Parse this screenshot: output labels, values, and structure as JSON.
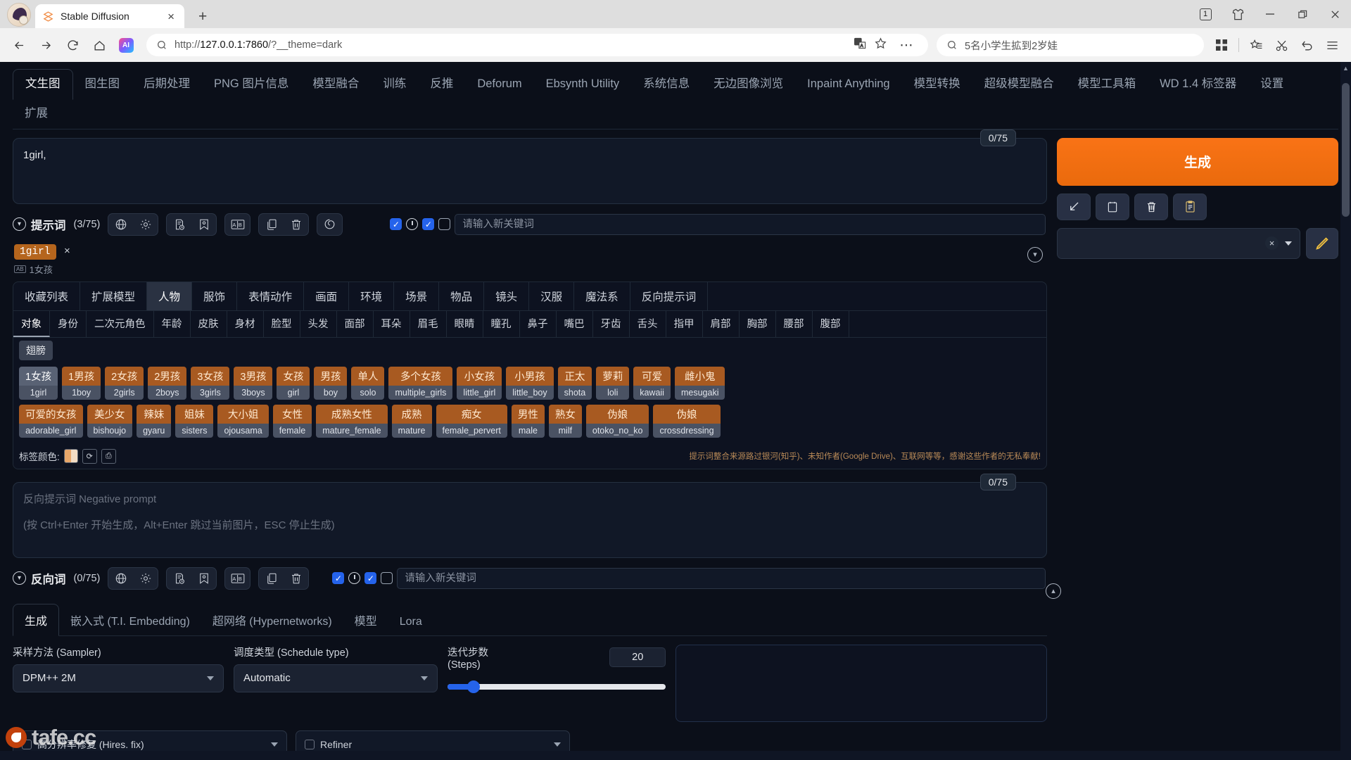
{
  "browser": {
    "tab_title": "Stable Diffusion",
    "tab_close": "×",
    "new_tab": "+",
    "tab_count": "1",
    "minimize": "—",
    "maximize": "❐",
    "close": "✕",
    "url_scheme": "http://",
    "url_host": "127.0.0.1:7860",
    "url_path": "/?__theme=dark",
    "search_query": "5名小学生拡到2岁娃",
    "icons": {
      "back": "back-icon",
      "forward": "forward-icon",
      "reload": "reload-icon",
      "home": "home-icon",
      "ai": "AI",
      "search": "search-icon",
      "translate": "translate-icon",
      "favorite": "star-icon",
      "more": "⋯",
      "apps": "apps-grid-icon",
      "collect": "star-plus-icon",
      "scissors": "scissors-icon",
      "undo": "undo-icon",
      "menu": "hamburger-menu-icon"
    }
  },
  "main_tabs": [
    {
      "label": "文生图",
      "active": true
    },
    {
      "label": "图生图",
      "active": false
    },
    {
      "label": "后期处理",
      "active": false
    },
    {
      "label": "PNG 图片信息",
      "active": false
    },
    {
      "label": "模型融合",
      "active": false
    },
    {
      "label": "训练",
      "active": false
    },
    {
      "label": "反推",
      "active": false
    },
    {
      "label": "Deforum",
      "active": false
    },
    {
      "label": "Ebsynth Utility",
      "active": false
    },
    {
      "label": "系统信息",
      "active": false
    },
    {
      "label": "无边图像浏览",
      "active": false
    },
    {
      "label": "Inpaint Anything",
      "active": false
    },
    {
      "label": "模型转换",
      "active": false
    },
    {
      "label": "超级模型融合",
      "active": false
    },
    {
      "label": "模型工具箱",
      "active": false
    },
    {
      "label": "WD 1.4 标签器",
      "active": false
    },
    {
      "label": "设置",
      "active": false
    },
    {
      "label": "扩展",
      "active": false
    }
  ],
  "prompt": {
    "counter": "0/75",
    "value": "1girl,",
    "placeholder": "",
    "label": "提示词",
    "count": "(3/75)",
    "keyword_placeholder": "请输入新关键词",
    "toolbar_icons": [
      "globe-icon",
      "gear-icon",
      "document-clock-icon",
      "bookmark-icon",
      "translate-ab-icon",
      "copy-icon",
      "trash-icon",
      "spiral-icon"
    ]
  },
  "negative": {
    "counter": "0/75",
    "placeholder_line1": "反向提示词 Negative prompt",
    "placeholder_line2": "(按 Ctrl+Enter 开始生成，Alt+Enter 跳过当前图片，ESC 停止生成)",
    "label": "反向词",
    "count": "(0/75)",
    "keyword_placeholder": "请输入新关键词"
  },
  "chip": {
    "text": "1girl",
    "remove": "×",
    "translation": "1女孩",
    "ab_badge": "AB"
  },
  "categories_row1": [
    {
      "label": "收藏列表",
      "active": false
    },
    {
      "label": "扩展模型",
      "active": false
    },
    {
      "label": "人物",
      "active": true
    },
    {
      "label": "服饰",
      "active": false
    },
    {
      "label": "表情动作",
      "active": false
    },
    {
      "label": "画面",
      "active": false
    },
    {
      "label": "环境",
      "active": false
    },
    {
      "label": "场景",
      "active": false
    },
    {
      "label": "物品",
      "active": false
    },
    {
      "label": "镜头",
      "active": false
    },
    {
      "label": "汉服",
      "active": false
    },
    {
      "label": "魔法系",
      "active": false
    },
    {
      "label": "反向提示词",
      "active": false
    }
  ],
  "categories_row2": [
    {
      "label": "对象",
      "active": true
    },
    {
      "label": "身份",
      "active": false
    },
    {
      "label": "二次元角色",
      "active": false
    },
    {
      "label": "年龄",
      "active": false
    },
    {
      "label": "皮肤",
      "active": false
    },
    {
      "label": "身材",
      "active": false
    },
    {
      "label": "脸型",
      "active": false
    },
    {
      "label": "头发",
      "active": false
    },
    {
      "label": "面部",
      "active": false
    },
    {
      "label": "耳朵",
      "active": false
    },
    {
      "label": "眉毛",
      "active": false
    },
    {
      "label": "眼睛",
      "active": false
    },
    {
      "label": "瞳孔",
      "active": false
    },
    {
      "label": "鼻子",
      "active": false
    },
    {
      "label": "嘴巴",
      "active": false
    },
    {
      "label": "牙齿",
      "active": false
    },
    {
      "label": "舌头",
      "active": false
    },
    {
      "label": "指甲",
      "active": false
    },
    {
      "label": "肩部",
      "active": false
    },
    {
      "label": "胸部",
      "active": false
    },
    {
      "label": "腰部",
      "active": false
    },
    {
      "label": "腹部",
      "active": false
    }
  ],
  "categories_row3": [
    {
      "label": "翅膀",
      "active": false
    }
  ],
  "tags": [
    [
      {
        "cn": "1女孩",
        "en": "1girl",
        "selected": true
      },
      {
        "cn": "1男孩",
        "en": "1boy",
        "selected": false
      },
      {
        "cn": "2女孩",
        "en": "2girls",
        "selected": false
      },
      {
        "cn": "2男孩",
        "en": "2boys",
        "selected": false
      },
      {
        "cn": "3女孩",
        "en": "3girls",
        "selected": false
      },
      {
        "cn": "3男孩",
        "en": "3boys",
        "selected": false
      },
      {
        "cn": "女孩",
        "en": "girl",
        "selected": false
      },
      {
        "cn": "男孩",
        "en": "boy",
        "selected": false
      },
      {
        "cn": "单人",
        "en": "solo",
        "selected": false
      },
      {
        "cn": "多个女孩",
        "en": "multiple_girls",
        "selected": false
      },
      {
        "cn": "小女孩",
        "en": "little_girl",
        "selected": false
      },
      {
        "cn": "小男孩",
        "en": "little_boy",
        "selected": false
      },
      {
        "cn": "正太",
        "en": "shota",
        "selected": false
      },
      {
        "cn": "萝莉",
        "en": "loli",
        "selected": false
      },
      {
        "cn": "可爱",
        "en": "kawaii",
        "selected": false
      },
      {
        "cn": "雌小鬼",
        "en": "mesugaki",
        "selected": false
      }
    ],
    [
      {
        "cn": "可爱的女孩",
        "en": "adorable_girl",
        "selected": false
      },
      {
        "cn": "美少女",
        "en": "bishoujo",
        "selected": false
      },
      {
        "cn": "辣妹",
        "en": "gyaru",
        "selected": false
      },
      {
        "cn": "姐妹",
        "en": "sisters",
        "selected": false
      },
      {
        "cn": "大小姐",
        "en": "ojousama",
        "selected": false
      },
      {
        "cn": "女性",
        "en": "female",
        "selected": false
      },
      {
        "cn": "成熟女性",
        "en": "mature_female",
        "selected": false
      },
      {
        "cn": "成熟",
        "en": "mature",
        "selected": false
      },
      {
        "cn": "痴女",
        "en": "female_pervert",
        "selected": false
      },
      {
        "cn": "男性",
        "en": "male",
        "selected": false
      },
      {
        "cn": "熟女",
        "en": "milf",
        "selected": false
      },
      {
        "cn": "伪娘",
        "en": "otoko_no_ko",
        "selected": false
      },
      {
        "cn": "伪娘",
        "en": "crossdressing",
        "selected": false
      }
    ]
  ],
  "cat_footer": {
    "color_label": "标签颜色:",
    "credit": "提示词整合来源路过银河(知乎)、未知作者(Google Drive)、互联网等等，感谢这些作者的无私奉献!"
  },
  "right_panel": {
    "generate_label": "生成",
    "action_icons": [
      "arrow-down-left-icon",
      "notepad-icon",
      "trash-icon",
      "clipboard-icon"
    ],
    "style_clear": "×",
    "style_value": "",
    "pencil": "pencil-icon"
  },
  "bottom_tabs": [
    {
      "label": "生成",
      "active": true
    },
    {
      "label": "嵌入式 (T.I. Embedding)",
      "active": false
    },
    {
      "label": "超网络 (Hypernetworks)",
      "active": false
    },
    {
      "label": "模型",
      "active": false
    },
    {
      "label": "Lora",
      "active": false
    }
  ],
  "settings": {
    "sampler_label": "采样方法 (Sampler)",
    "sampler_value": "DPM++ 2M",
    "schedule_label": "调度类型 (Schedule type)",
    "schedule_value": "Automatic",
    "steps_label": "迭代步数 (Steps)",
    "steps_value": "20",
    "hires_label": "高分辨率修复 (Hires. fix)",
    "refiner_label": "Refiner"
  },
  "watermark": "tafe.cc"
}
